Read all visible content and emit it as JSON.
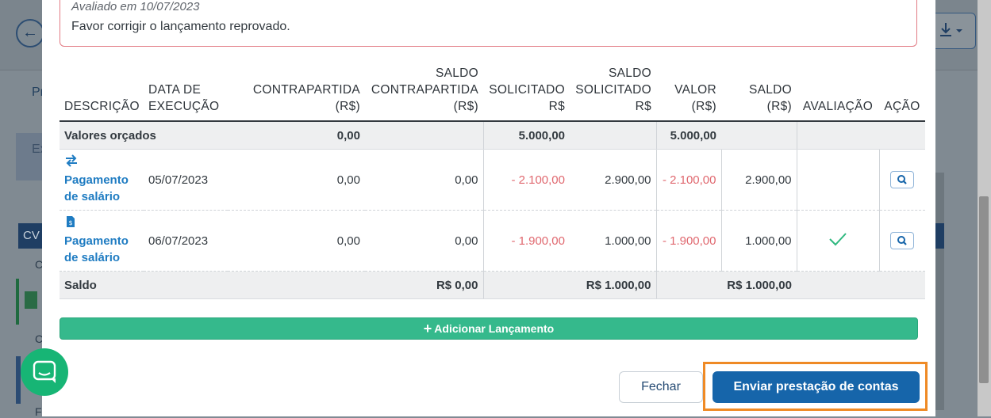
{
  "background": {
    "back_label": "←",
    "tab_label": "Pr",
    "card_label": "Ex",
    "cv_label": "CV",
    "c1": "C",
    "c2": "C",
    "c3": "Fe",
    "right_text": "o"
  },
  "alert": {
    "evaluated_on": "Avaliado em 10/07/2023",
    "message": "Favor corrigir o lançamento reprovado."
  },
  "table": {
    "headers": {
      "descricao": "DESCRIÇÃO",
      "data1": "DATA DE",
      "data2": "EXECUÇÃO",
      "contra1": "CONTRAPARTIDA",
      "contra2": "(R$)",
      "saldo_contra1": "SALDO",
      "saldo_contra2": "CONTRAPARTIDA",
      "saldo_contra3": "(R$)",
      "solicitado1": "SOLICITADO",
      "solicitado2": "R$",
      "saldo_sol1": "SALDO",
      "saldo_sol2": "SOLICITADO",
      "saldo_sol3": "R$",
      "valor1": "VALOR",
      "valor2": "(R$)",
      "saldo1": "SALDO",
      "saldo2": "(R$)",
      "avaliacao": "AVALIAÇÃO",
      "acao": "AÇÃO"
    },
    "budget_row": {
      "label": "Valores orçados",
      "contrapartida": "0,00",
      "solicitado": "5.000,00",
      "valor": "5.000,00"
    },
    "rows": [
      {
        "icon": "transfer-icon",
        "desc1": "Pagamento",
        "desc2": "de salário",
        "date": "05/07/2023",
        "contrapartida": "0,00",
        "saldo_contrapartida": "0,00",
        "solicitado": "- 2.100,00",
        "saldo_solicitado": "2.900,00",
        "valor": "- 2.100,00",
        "saldo": "2.900,00",
        "evaluation": ""
      },
      {
        "icon": "invoice-icon",
        "desc1": "Pagamento",
        "desc2": "de salário",
        "date": "06/07/2023",
        "contrapartida": "0,00",
        "saldo_contrapartida": "0,00",
        "solicitado": "- 1.900,00",
        "saldo_solicitado": "1.000,00",
        "valor": "- 1.900,00",
        "saldo": "1.000,00",
        "evaluation": "approved-check-icon"
      }
    ],
    "saldo_row": {
      "label": "Saldo",
      "contrapartida": "R$ 0,00",
      "solicitado": "R$ 1.000,00",
      "valor": "R$ 1.000,00"
    }
  },
  "actions": {
    "add_label": "Adicionar Lançamento",
    "close_label": "Fechar",
    "submit_label": "Enviar prestação de contas"
  },
  "colors": {
    "primary": "#1665aa",
    "success": "#35b98c",
    "negative": "#e0686f",
    "highlight": "#ef8a25",
    "alert_border": "#e27b84",
    "link": "#1f7cc2"
  }
}
